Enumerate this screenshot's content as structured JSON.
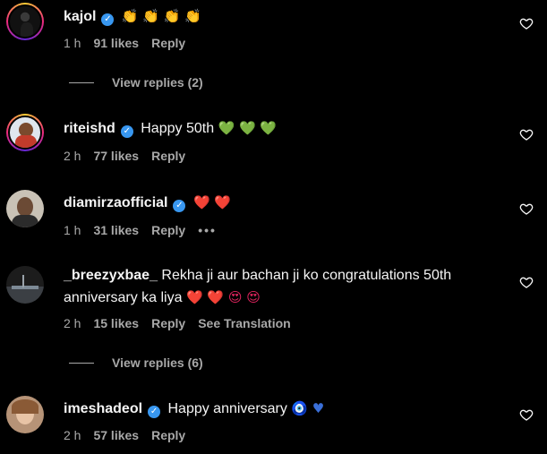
{
  "comments": [
    {
      "username": "kajol",
      "text": "",
      "emojis": "👏 👏 👏 👏",
      "time": "1 h",
      "likes": "91 likes",
      "reply": "Reply"
    },
    {
      "username": "riteishd",
      "text": "Happy 50th",
      "emojis": "💚 💚 💚",
      "time": "2 h",
      "likes": "77 likes",
      "reply": "Reply"
    },
    {
      "username": "diamirzaofficial",
      "text": "",
      "emojis": "❤️ ❤️",
      "time": "1 h",
      "likes": "31 likes",
      "reply": "Reply",
      "more": "•••"
    },
    {
      "username": "_breezyxbae_",
      "text": "Rekha ji aur bachan ji ko congratulations 50th anniversary ka liya",
      "emojis": "❤️ ❤️ 😍 😍",
      "time": "2 h",
      "likes": "15 likes",
      "reply": "Reply",
      "translate": "See Translation"
    },
    {
      "username": "imeshadeol",
      "text": "Happy anniversary",
      "emojis": "🧿 ♥",
      "time": "2 h",
      "likes": "57 likes",
      "reply": "Reply"
    }
  ],
  "view_replies": [
    "View replies (2)",
    "View replies (6)"
  ],
  "icons": {
    "like": "heart-outline-icon",
    "verified": "verified-badge-icon"
  },
  "colors": {
    "background": "#000000",
    "verified": "#3897f0",
    "muted": "#a8a8a8"
  }
}
